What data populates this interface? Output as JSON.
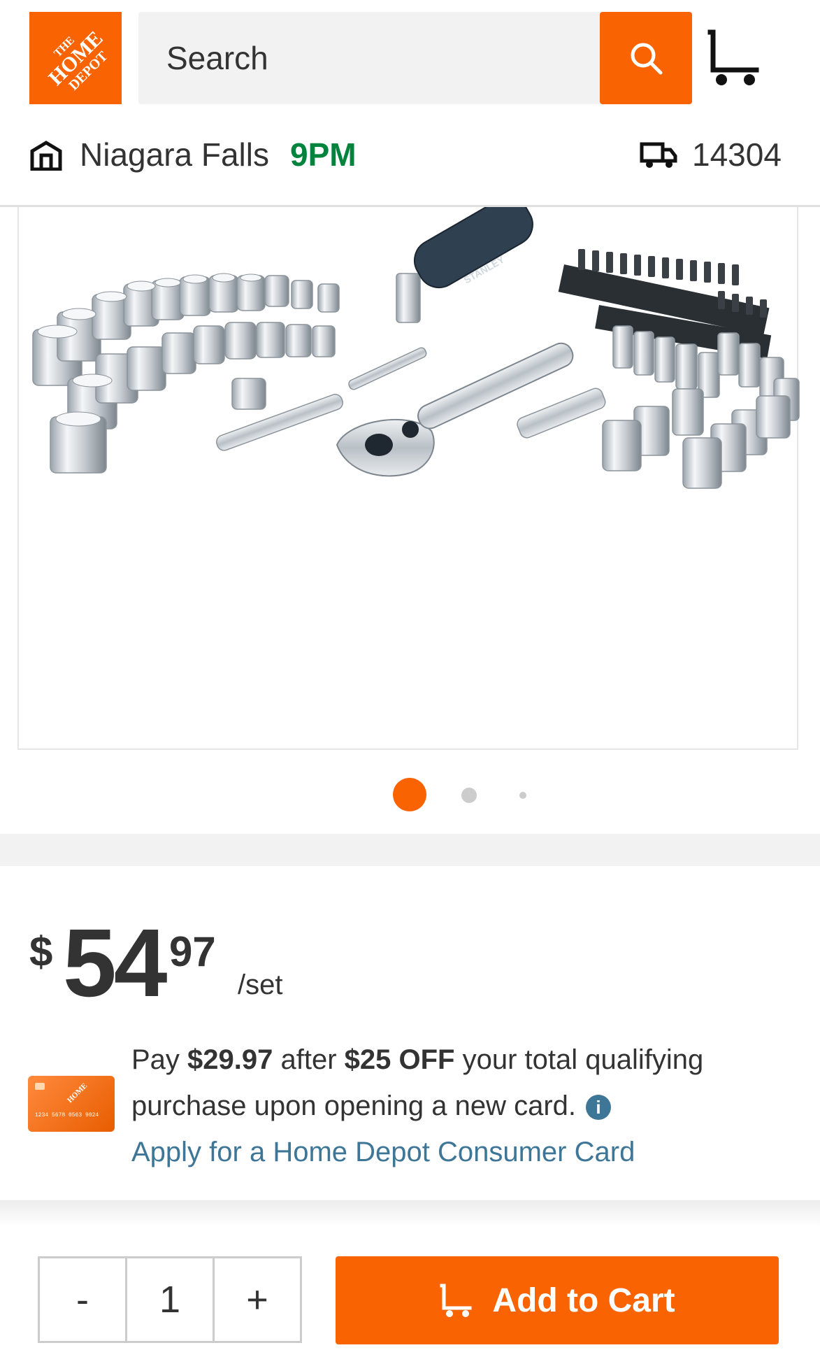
{
  "header": {
    "logo_text": "THE HOME DEPOT",
    "search_placeholder": "Search",
    "store_name": "Niagara Falls",
    "store_hours": "9PM",
    "zip": "14304"
  },
  "carousel": {
    "dots": 3,
    "active_index": 0,
    "product_image": "Socket set with ratchet, extensions and bits",
    "brand_on_handle": "STANLEY"
  },
  "price": {
    "dollar_sign": "$",
    "whole": "54",
    "cents": "97",
    "unit": "/set"
  },
  "promo": {
    "pay_prefix": "Pay ",
    "pay_amount": "$29.97",
    "after": " after ",
    "discount": "$25 OFF",
    "rest": " your total qualifying purchase upon opening a new card.",
    "info_symbol": "i",
    "apply_link": "Apply for a Home Depot Consumer Card"
  },
  "bottom_bar": {
    "minus": "-",
    "quantity": "1",
    "plus": "+",
    "add_to_cart": "Add to Cart"
  },
  "colors": {
    "brand_orange": "#f96302",
    "store_hours_green": "#00843d",
    "link_blue": "#3e7697"
  }
}
